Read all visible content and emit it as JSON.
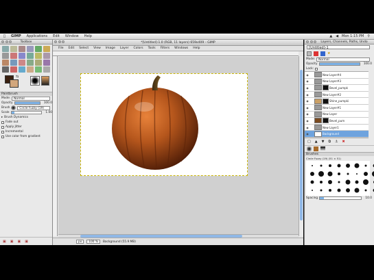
{
  "menubar": {
    "app": "GIMP",
    "items": [
      "Applications",
      "Edit",
      "Window",
      "Help"
    ],
    "right_time": "Mon 1:15 PM"
  },
  "toolbox": {
    "title": "Toolbox",
    "options_title": "Paintbrush",
    "mode_label": "Mode:",
    "mode_value": "Normal",
    "opacity_label": "Opacity",
    "opacity_value": "100.0",
    "opacity_level": 1.0,
    "brush_label": "Brush",
    "brush_value": "Circle Fuzzy (19)",
    "scale_label": "Scale",
    "scale_value": "1.00",
    "scale_level": 0.1,
    "dynamics_label": "Brush Dynamics",
    "fade_label": "Fade out",
    "jitter_label": "Apply Jitter",
    "incremental_label": "Incremental",
    "gradient_label": "Use color from gradient"
  },
  "image_window": {
    "title": "*[Untitled]-1.0 (RGB, 11 layers) 659x409 – GIMP",
    "menu": [
      "File",
      "Edit",
      "Select",
      "View",
      "Image",
      "Layer",
      "Colors",
      "Tools",
      "Filters",
      "Windows",
      "Help"
    ],
    "unit": "px",
    "zoom": "100 %",
    "status": "Background (55.9 MB)"
  },
  "dock": {
    "title": "Layers, Channels, Paths, Undo",
    "image_select": "[Untitled]-1",
    "mode_label": "Mode:",
    "mode_value": "Normal",
    "opacity_label": "Opacity",
    "opacity_value": "100.0",
    "opacity_level": 1.0,
    "lock_label": "Lock:",
    "layers": [
      {
        "name": "New Layer#4",
        "mask": false
      },
      {
        "name": "New Layer#3",
        "mask": false
      },
      {
        "name": "Bevel_pumpk",
        "mask": true
      },
      {
        "name": "New Layer#2",
        "mask": false
      },
      {
        "name": "Shine_pumpki",
        "mask": true
      },
      {
        "name": "New Layer#1",
        "mask": false
      },
      {
        "name": "New Layer",
        "mask": false
      },
      {
        "name": "Bevel_pum",
        "mask": true
      },
      {
        "name": "New Layer1",
        "mask": false
      },
      {
        "name": "Background",
        "mask": false,
        "selected": true
      }
    ],
    "brushes_title": "Brushes",
    "brush_name": "Circle Fuzzy (19) (51 × 51)",
    "spacing_label": "Spacing",
    "spacing_value": "10.0"
  },
  "colors": {
    "accent": "#6ea3de",
    "pumpkin": "#b5561c",
    "canvas": "#ffffff"
  }
}
